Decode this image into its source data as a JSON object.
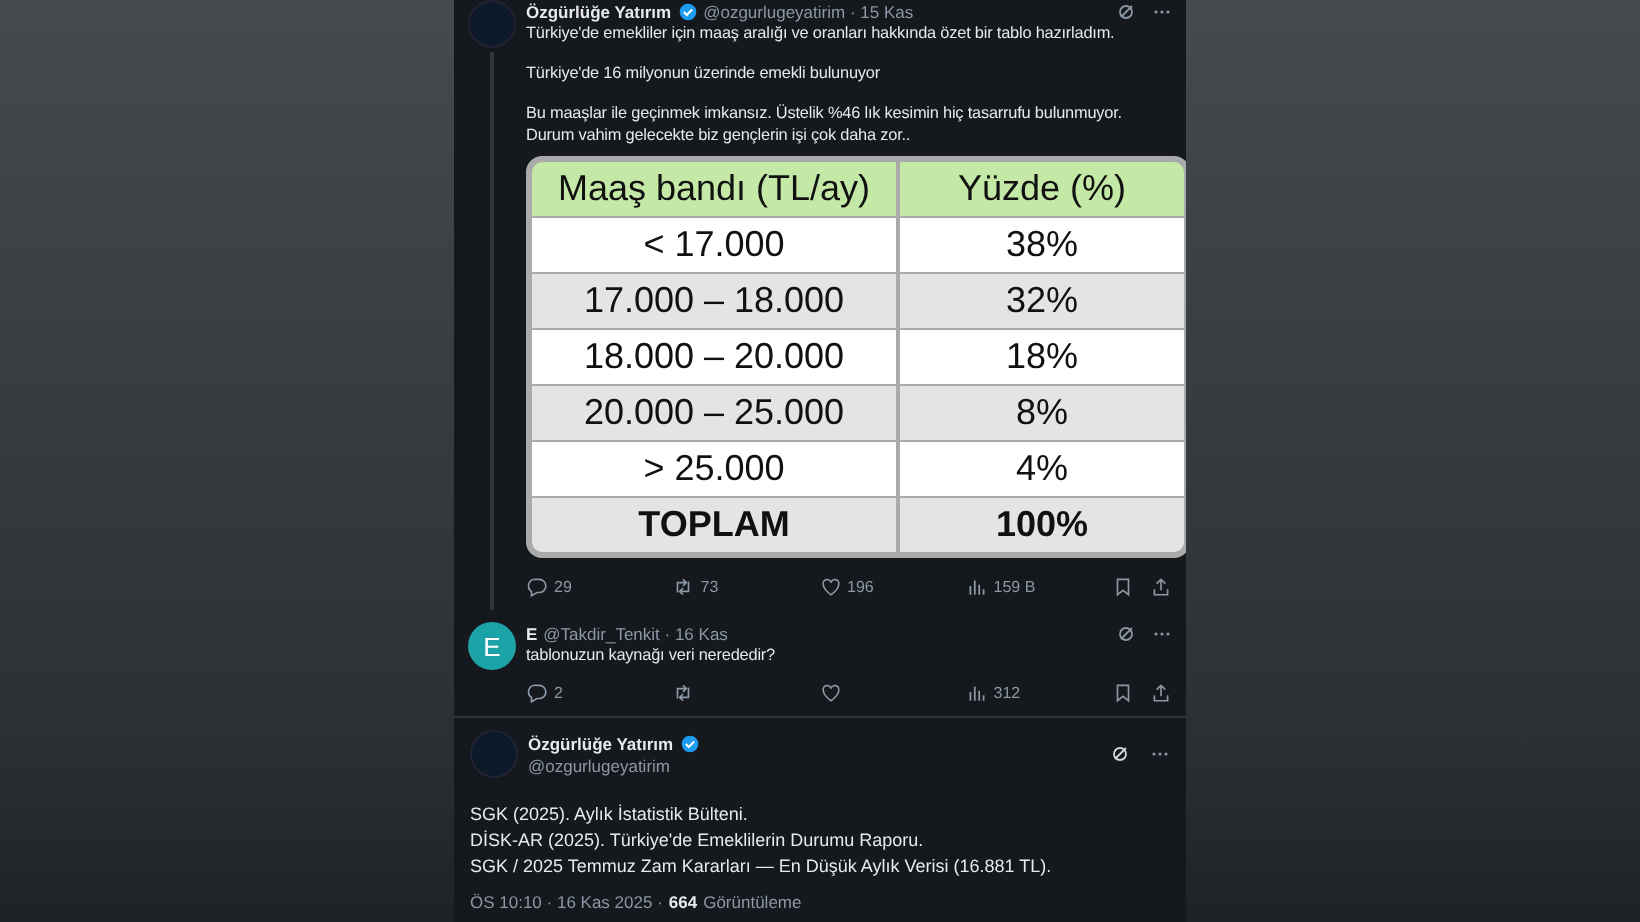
{
  "tweets": [
    {
      "kind": "main",
      "author": "Özgürlüğe Yatırım",
      "verified": true,
      "handle": "@ozgurlugeyatirim · 15 Kas",
      "paragraphs": [
        "Türkiye'de emekliler için maaş aralığı ve oranları hakkında özet bir tablo hazırladım.",
        "Türkiye'de 16 milyonun üzerinde emekli bulunuyor",
        "Bu maaşlar ile geçinmek imkansız. Üstelik %46 lık kesimin hiç tasarrufu bulunmuyor. Durum vahim gelecekte biz gençlerin işi çok daha zor.."
      ],
      "table": {
        "columns": [
          "Maaş bandı (TL/ay)",
          "Yüzde (%)"
        ],
        "rows": [
          {
            "cells": [
              "< 17.000",
              "38%"
            ],
            "total": false
          },
          {
            "cells": [
              "17.000 – 18.000",
              "32%"
            ],
            "total": false
          },
          {
            "cells": [
              "18.000 – 20.000",
              "18%"
            ],
            "total": false
          },
          {
            "cells": [
              "20.000 – 25.000",
              "8%"
            ],
            "total": false
          },
          {
            "cells": [
              "> 25.000",
              "4%"
            ],
            "total": false
          },
          {
            "cells": [
              "TOPLAM",
              "100%"
            ],
            "total": true
          }
        ]
      },
      "actions": {
        "replies": "29",
        "reposts": "73",
        "likes": "196",
        "views": "159 B"
      }
    },
    {
      "kind": "reply",
      "author": "E",
      "verified": false,
      "handle": "@Takdir_Tenkit · 16 Kas",
      "avatar_letter": "E",
      "paragraphs": [
        "tablonuzun kaynağı veri nerededir?"
      ],
      "actions": {
        "replies": "2",
        "views": "312"
      }
    },
    {
      "kind": "focus",
      "author": "Özgürlüğe Yatırım",
      "verified": true,
      "handle": "@ozgurlugeyatirim",
      "paragraphs": [
        "SGK (2025). Aylık İstatistik Bülteni.",
        "DİSK-AR (2025). Türkiye'de Emeklilerin Durumu Raporu.",
        "SGK / 2025 Temmuz Zam Kararları — En Düşük Aylık Verisi (16.881 TL)."
      ],
      "footer": {
        "time": "ÖS 10:10 · 16 Kas 2025 ·",
        "views_count": "664",
        "views_label": "Görüntüleme"
      }
    }
  ]
}
